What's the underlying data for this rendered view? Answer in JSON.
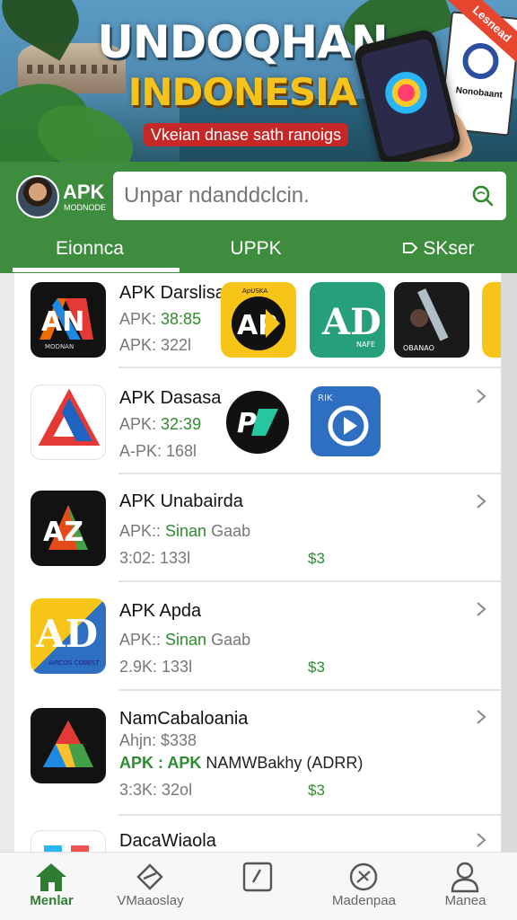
{
  "banner": {
    "title_line1": "UNDOQHAN",
    "title_line2": "INDONESIA",
    "tagline": "Vkeian dnase sath ranoigs",
    "ribbon": "Lesnead",
    "sign_text": "Nonobaant"
  },
  "header": {
    "brand": "APK",
    "brand_sub": "MODNODE",
    "search_placeholder": "Unpar ndanddclcin.",
    "tabs": [
      {
        "label": "Eionnca"
      },
      {
        "label": "UPPK"
      },
      {
        "label": "SKser"
      }
    ],
    "colors": {
      "header": "#3e8c3e",
      "accent_green": "#2e8b2e"
    }
  },
  "list": {
    "rows": [
      {
        "title": "APK Darslisa",
        "meta1_a": "APK: ",
        "meta1_b": "38:85",
        "meta2": "APK: 322l"
      },
      {
        "title": "APK Dasasa",
        "meta1_a": "APK: ",
        "meta1_b": "32:39",
        "meta2": "A-PK: 168l"
      },
      {
        "title": "APK Unabairda",
        "meta1_a": "APK:: ",
        "meta1_b": "Sinan",
        "meta1_c": "Gaab",
        "meta2": "3:02: 133l",
        "price": "$3"
      },
      {
        "title": "APK Apda",
        "meta1_a": "APK:: ",
        "meta1_b": "Sinan",
        "meta1_c": "Gaab",
        "meta2": "2.9K: 133l",
        "price": "$3"
      },
      {
        "title": "NamCabaloania",
        "meta1_a": "Ahjn: $338",
        "meta2_a": "APK : APK ",
        "meta2_b": "NAMWBakhy (ADRR)",
        "meta3": "3:3K: 32ol",
        "price": "$3"
      },
      {
        "title": "DacaWiaola"
      }
    ],
    "inline_tile_labels": {
      "tile_ap_small": "ApUSKA",
      "tile_ad_small": "NAFE",
      "tile_guitar": "OBANAO",
      "tile_play": "RIK",
      "tile_ad_big": "AIRCOS COBEST",
      "tile_first": "MODNAN"
    }
  },
  "bottom_nav": {
    "items": [
      {
        "label": "Menlar",
        "icon": "home-icon"
      },
      {
        "label": "VMaaoslay",
        "icon": "pencil-leaf-icon"
      },
      {
        "label": "",
        "icon": "edit-square-icon"
      },
      {
        "label": "Madenpaa",
        "icon": "scissors-circle-icon"
      },
      {
        "label": "Manea",
        "icon": "person-icon"
      }
    ]
  }
}
